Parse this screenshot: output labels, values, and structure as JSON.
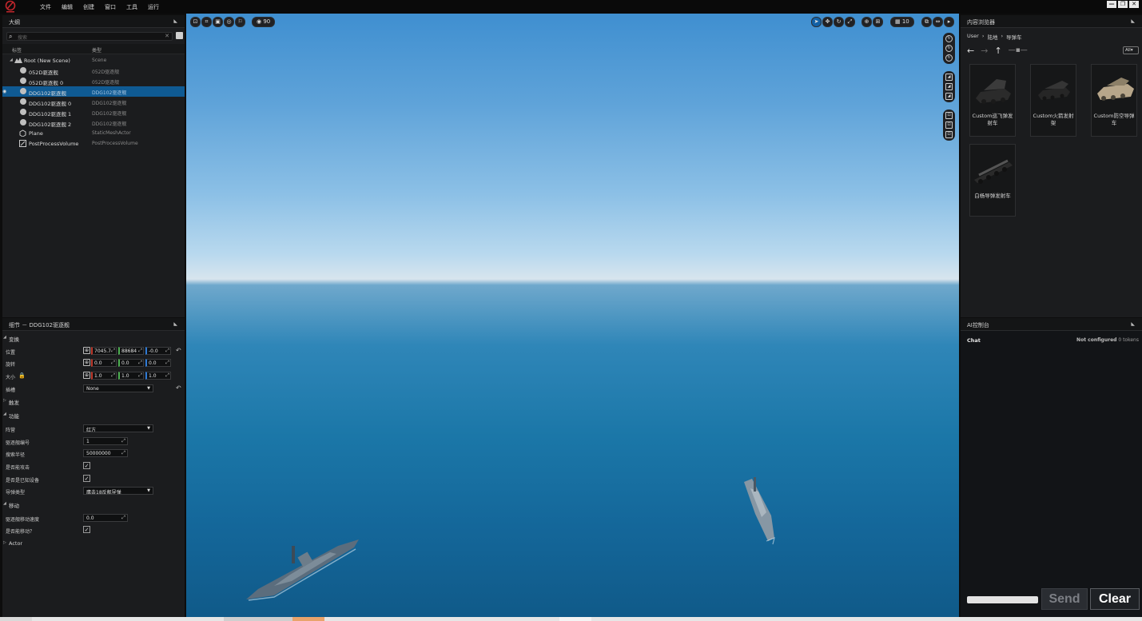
{
  "menubar": {
    "items": [
      "文件",
      "编辑",
      "创建",
      "窗口",
      "工具",
      "运行"
    ],
    "window_controls": [
      "—",
      "❐",
      "✕"
    ]
  },
  "outliner": {
    "title": "大纲",
    "search_placeholder": "搜索",
    "columns": {
      "label": "标签",
      "type": "类型"
    },
    "rows": [
      {
        "name": "Root (New Scene)",
        "type": "Scene"
      },
      {
        "name": "052D驱逐舰",
        "type": "052D驱逐舰"
      },
      {
        "name": "052D驱逐舰 0",
        "type": "052D驱逐舰"
      },
      {
        "name": "DDG102驱逐舰",
        "type": "DDG102驱逐舰"
      },
      {
        "name": "DDG102驱逐舰 0",
        "type": "DDG102驱逐舰"
      },
      {
        "name": "DDG102驱逐舰 1",
        "type": "DDG102驱逐舰"
      },
      {
        "name": "DDG102驱逐舰 2",
        "type": "DDG102驱逐舰"
      },
      {
        "name": "Plane",
        "type": "StaticMeshActor"
      },
      {
        "name": "PostProcessVolume",
        "type": "PostProcessVolume"
      }
    ]
  },
  "details": {
    "title": "细节 － DDG102驱逐舰",
    "sections": {
      "transform": "变换",
      "trigger": "触发",
      "function": "功能",
      "move": "移动",
      "actor": "Actor"
    },
    "labels": {
      "position": "位置",
      "rotation": "旋转",
      "scale": "大小",
      "socket": "插槽",
      "camp": "阵营",
      "ship_no": "驱逐舰编号",
      "search_radius": "搜索半径",
      "can_attack": "是否能攻击",
      "has_equipment": "是否是已知设备",
      "missile_type": "导弹类型",
      "move_speed": "驱逐舰移动速度",
      "can_move": "是否能移动？"
    },
    "values": {
      "position": [
        "7045.7",
        "88684",
        "-0.0"
      ],
      "rotation": [
        "0.0",
        "0.0",
        "0.0"
      ],
      "scale": [
        "1.0",
        "1.0",
        "1.0"
      ],
      "socket": "None",
      "camp": "红方",
      "ship_no": "1",
      "search_radius": "50000000",
      "missile_type": "鹰击18反舰导弹",
      "move_speed": "0.0"
    }
  },
  "viewport": {
    "fov": "90",
    "grid": "10"
  },
  "content_browser": {
    "title": "内容浏览器",
    "breadcrumb": [
      "User",
      "陆地",
      "导弹车"
    ],
    "filter": "All",
    "items": [
      {
        "name": "Custom巡飞弹发射车"
      },
      {
        "name": "Custom火箭发射架"
      },
      {
        "name": "Custom防空导弹车"
      },
      {
        "name": "白杨导弹发射车"
      }
    ]
  },
  "ai_console": {
    "title": "AI控制台",
    "chat_label": "Chat",
    "status": "Not configured",
    "tokens": "0 tokens",
    "send_label": "Send",
    "clear_label": "Clear"
  }
}
